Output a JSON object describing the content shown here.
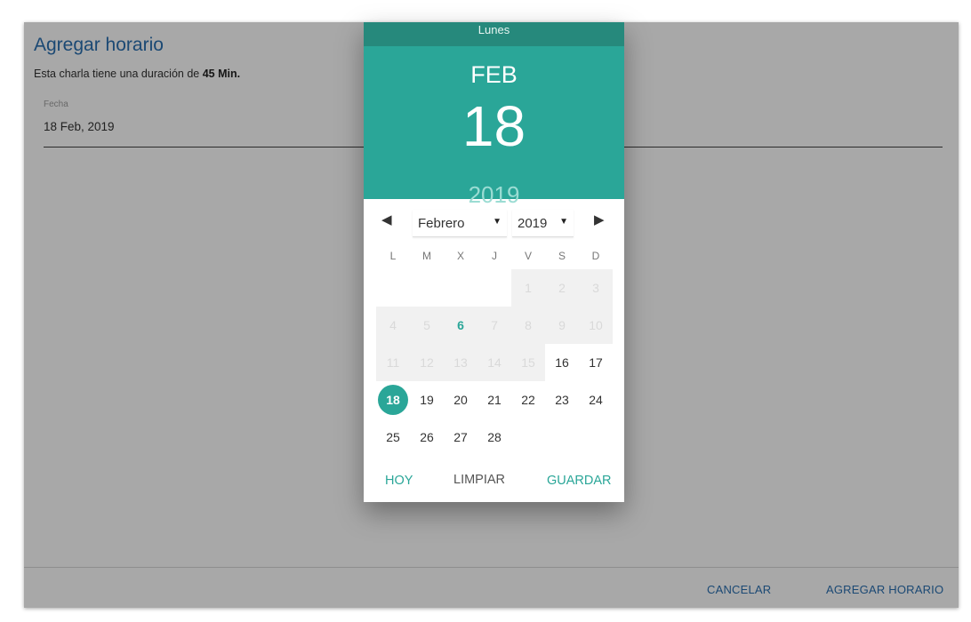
{
  "dialog": {
    "title": "Agregar horario",
    "subtitle_prefix": "Esta charla tiene una duración de",
    "duration": "45 Min.",
    "date_label": "Fecha",
    "date_value": "18 Feb, 2019",
    "cancel_label": "CANCELAR",
    "add_label": "AGREGAR HORARIO"
  },
  "picker": {
    "weekday_name": "Lunes",
    "month_abbr": "FEB",
    "day": "18",
    "year": "2019",
    "month_select": "Febrero",
    "year_select": "2019",
    "weekday_headers": [
      "L",
      "M",
      "X",
      "J",
      "V",
      "S",
      "D"
    ],
    "first_weekday_index": 4,
    "days_in_month": 28,
    "disabled_through": 15,
    "today_day": 6,
    "selected_day": 18,
    "today_label": "HOY",
    "clear_label": "LIMPIAR",
    "save_label": "GUARDAR",
    "icons": {
      "prev": "triangle-left-icon",
      "next": "triangle-right-icon",
      "caret": "caret-down-icon"
    }
  },
  "colors": {
    "accent": "#2aa698",
    "accent_dark": "#26897c",
    "link_blue": "#2a6fb0"
  }
}
